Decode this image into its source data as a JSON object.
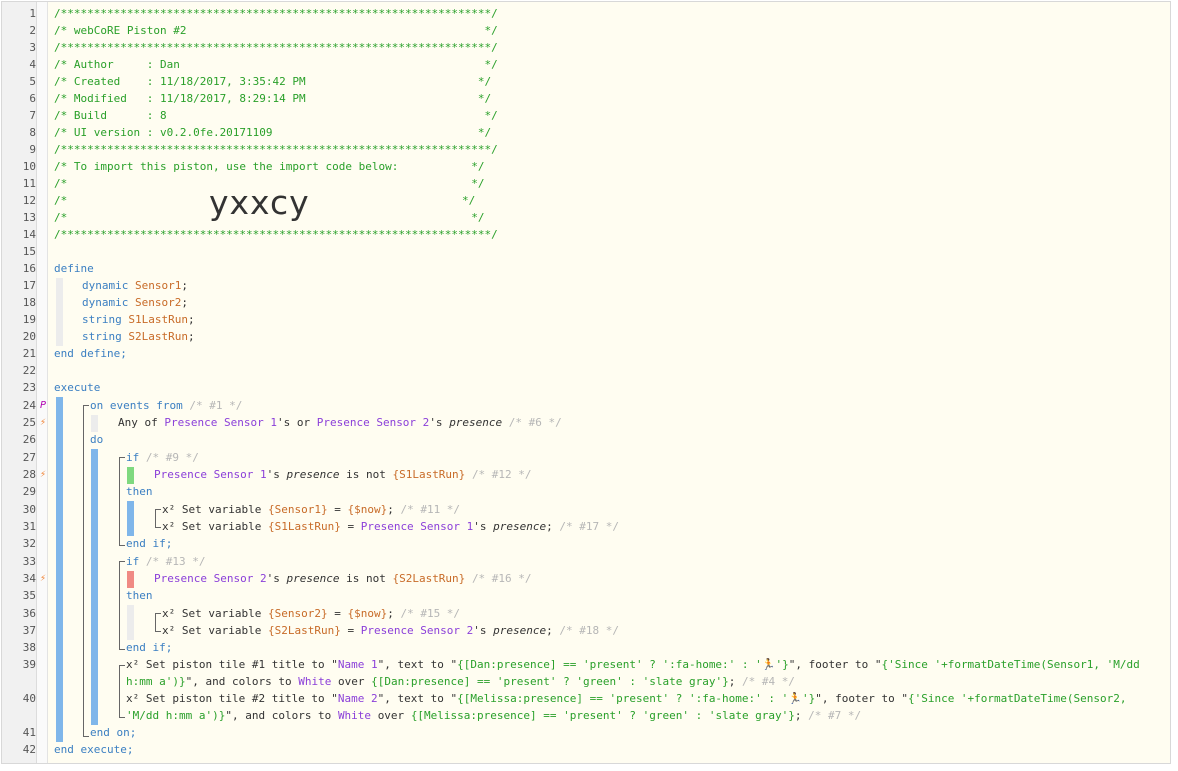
{
  "gutter": {
    "line_numbers": [
      "1",
      "2",
      "3",
      "4",
      "5",
      "6",
      "7",
      "8",
      "9",
      "10",
      "11",
      "12",
      "13",
      "14",
      "15",
      "16",
      "17",
      "18",
      "19",
      "20",
      "21",
      "22",
      "23",
      "24",
      "25",
      "26",
      "27",
      "28",
      "29",
      "30",
      "31",
      "32",
      "33",
      "34",
      "35",
      "36",
      "37",
      "38",
      "39",
      "40",
      "41",
      "42"
    ]
  },
  "markers": {
    "p": "P",
    "bolt": "⚡"
  },
  "header": {
    "rule": "/*****************************************************************/",
    "title": "/* webCoRE Piston #2                                             */",
    "author": "/* Author     : Dan                                              */",
    "created": "/* Created    : 11/18/2017, 3:35:42 PM                          */",
    "modified": "/* Modified   : 11/18/2017, 8:29:14 PM                          */",
    "build": "/* Build      : 8                                                */",
    "ui_version": "/* UI version : v0.2.0fe.20171109                               */",
    "import_note": "/* To import this piston, use the import code below:           */",
    "blank_comment": "/*                                                             */",
    "blank_open": "/*",
    "blank_close": "*/",
    "import_code": "yxxcy"
  },
  "code": {
    "define": "define",
    "end_define": "end define;",
    "dynamic": "dynamic",
    "string": "string",
    "sensor1": "Sensor1",
    "sensor2": "Sensor2",
    "s1lastrun": "S1LastRun",
    "s2lastrun": "S2LastRun",
    "semicolon": ";",
    "execute": "execute",
    "end_execute": "end execute;",
    "on_events_from": "on events from",
    "c1": "/* #1 */",
    "any_of": "Any of",
    "ps1": "Presence Sensor 1",
    "ps2": "Presence Sensor 2",
    "s_or": "'s or",
    "apostrophe_s": "'s",
    "presence": "presence",
    "c6": "/* #6 */",
    "do": "do",
    "if": "if",
    "c9": "/* #9 */",
    "is_not": "is not",
    "s1lastrun_var": "{S1LastRun}",
    "s2lastrun_var": "{S2LastRun}",
    "c12": "/* #12 */",
    "then": "then",
    "set_variable": "x² Set variable",
    "sensor1_var": "{Sensor1}",
    "sensor2_var": "{Sensor2}",
    "eq": "=",
    "now_var": "{$now}",
    "c11": "/* #11 */",
    "c17": "/* #17 */",
    "end_if": "end if;",
    "c13": "/* #13 */",
    "c16": "/* #16 */",
    "c15": "/* #15 */",
    "c18": "/* #18 */",
    "tile1_a": "x² Set piston tile #1 title to \"",
    "tile_name1": "Name 1",
    "tile_text_to": "\", text to \"",
    "tile1_text": "{[Dan:presence] == 'present' ? ':fa-home:' : '🏃'}",
    "tile_footer_to": "\", footer to \"",
    "tile1_footer_a": "{'Since '+formatDateTime(Sensor1, 'M/dd",
    "tile1_footer_b": "h:mm a')}",
    "tile_colors_to": "\", and colors to",
    "white": "White",
    "over": "over",
    "tile1_over": "{[Dan:presence] == 'present' ? 'green' : 'slate gray'}",
    "c4": "/* #4 */",
    "tile2_a": "x² Set piston tile #2 title to \"",
    "tile_name2": "Name 2",
    "tile2_text": "{[Melissa:presence] == 'present' ? ':fa-home:' : '🏃'}",
    "tile2_footer_a": "{'Since '+formatDateTime(Sensor2,",
    "tile2_footer_b": "'M/dd h:mm a')}",
    "tile2_over": "{[Melissa:presence] == 'present' ? 'green' : 'slate gray'}",
    "c7": "/* #7 */",
    "end_on": "end on;"
  },
  "colors": {
    "exec_bar": "#7fb6ea",
    "cond_true": "#7fd97f",
    "cond_false": "#f08a84",
    "neutral_bar": "#ececec"
  }
}
